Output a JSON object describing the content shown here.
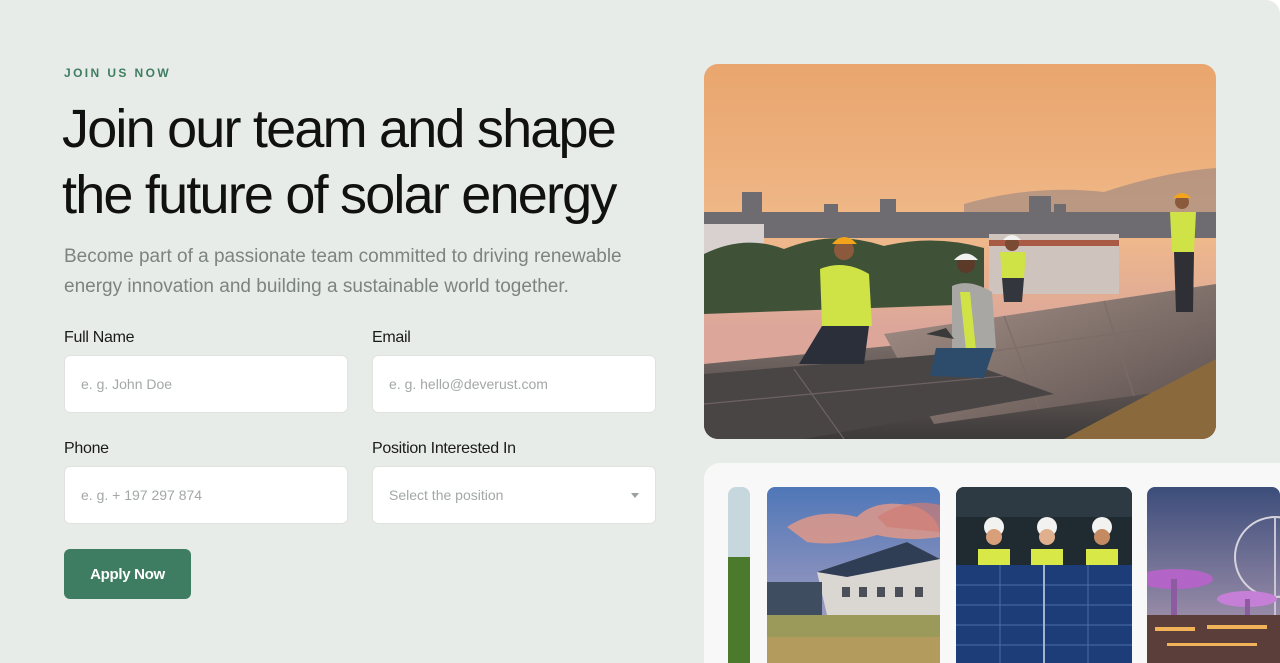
{
  "eyebrow": "JOIN US NOW",
  "headline_line1": "Join our team and shape",
  "headline_line2": "the future of solar energy",
  "subtext": "Become part of a passionate team committed to driving renewable energy innovation and building a sustainable world together.",
  "form": {
    "full_name": {
      "label": "Full Name",
      "placeholder": "e. g. John Doe"
    },
    "email": {
      "label": "Email",
      "placeholder": "e. g. hello@deverust.com"
    },
    "phone": {
      "label": "Phone",
      "placeholder": "e. g. + 197 297 874"
    },
    "position": {
      "label": "Position Interested In",
      "placeholder": "Select the position"
    },
    "submit_label": "Apply Now"
  },
  "colors": {
    "accent": "#3f7d62",
    "background": "#e8ece8"
  },
  "images": {
    "hero": "workers installing solar panels on rooftop at sunset",
    "thumb_1": "green field",
    "thumb_2": "house with solar roof",
    "thumb_3": "three workers behind solar panel",
    "thumb_4": "city skyline with ferris wheel"
  }
}
